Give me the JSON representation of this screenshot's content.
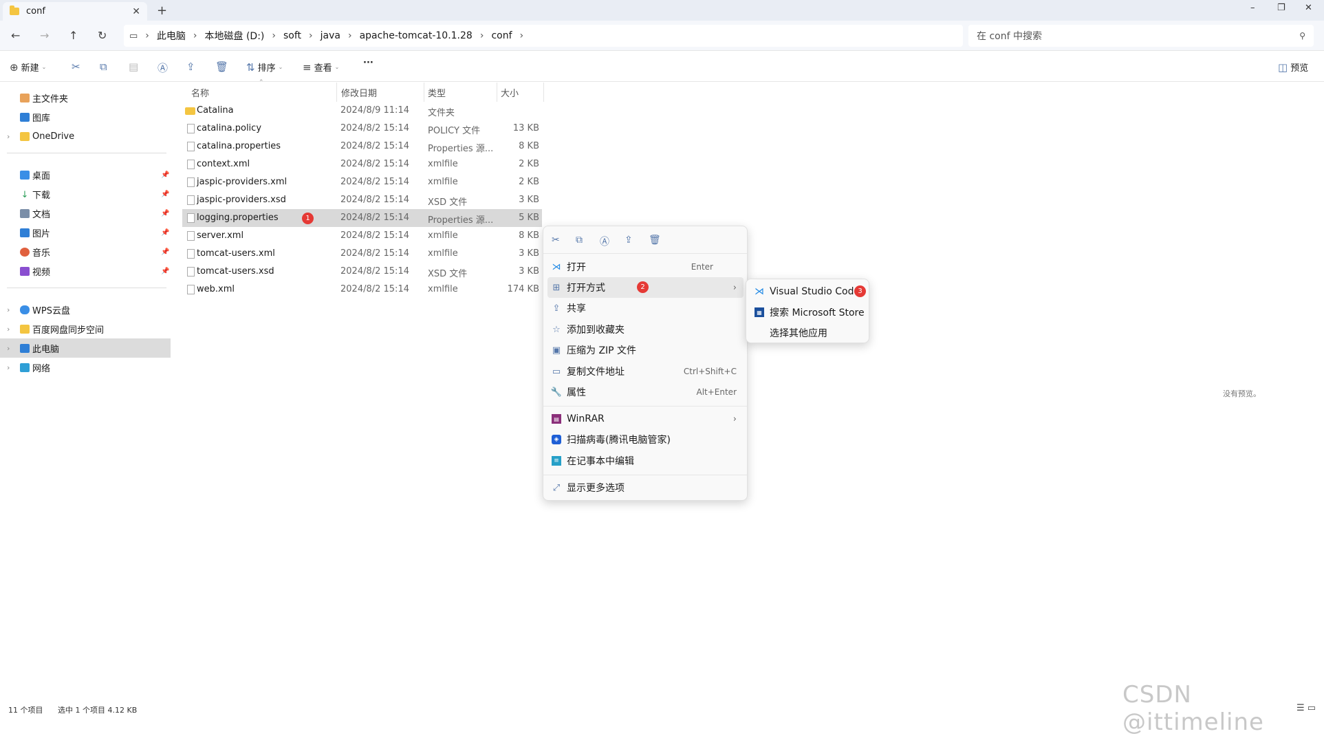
{
  "window": {
    "tab_title": "conf",
    "minimize": "–",
    "restore": "❐",
    "close": "✕"
  },
  "nav": {
    "crumbs": [
      "此电脑",
      "本地磁盘 (D:)",
      "soft",
      "java",
      "apache-tomcat-10.1.28",
      "conf"
    ],
    "search_placeholder": "在 conf 中搜索"
  },
  "toolbar": {
    "new_label": "新建",
    "sort_label": "排序",
    "view_label": "查看",
    "more": "···",
    "preview_label": "预览"
  },
  "sidebar": {
    "top": [
      "主文件夹",
      "图库",
      "OneDrive"
    ],
    "quick": [
      "桌面",
      "下载",
      "文档",
      "图片",
      "音乐",
      "视频"
    ],
    "bottom": [
      "WPS云盘",
      "百度网盘同步空间",
      "此电脑",
      "网络"
    ]
  },
  "columns": [
    "名称",
    "修改日期",
    "类型",
    "大小"
  ],
  "files": [
    {
      "name": "Catalina",
      "date": "2024/8/9 11:14",
      "type": "文件夹",
      "size": ""
    },
    {
      "name": "catalina.policy",
      "date": "2024/8/2 15:14",
      "type": "POLICY 文件",
      "size": "13 KB"
    },
    {
      "name": "catalina.properties",
      "date": "2024/8/2 15:14",
      "type": "Properties 源...",
      "size": "8 KB"
    },
    {
      "name": "context.xml",
      "date": "2024/8/2 15:14",
      "type": "xmlfile",
      "size": "2 KB"
    },
    {
      "name": "jaspic-providers.xml",
      "date": "2024/8/2 15:14",
      "type": "xmlfile",
      "size": "2 KB"
    },
    {
      "name": "jaspic-providers.xsd",
      "date": "2024/8/2 15:14",
      "type": "XSD 文件",
      "size": "3 KB"
    },
    {
      "name": "logging.properties",
      "date": "2024/8/2 15:14",
      "type": "Properties 源...",
      "size": "5 KB"
    },
    {
      "name": "server.xml",
      "date": "2024/8/2 15:14",
      "type": "xmlfile",
      "size": "8 KB"
    },
    {
      "name": "tomcat-users.xml",
      "date": "2024/8/2 15:14",
      "type": "xmlfile",
      "size": "3 KB"
    },
    {
      "name": "tomcat-users.xsd",
      "date": "2024/8/2 15:14",
      "type": "XSD 文件",
      "size": "3 KB"
    },
    {
      "name": "web.xml",
      "date": "2024/8/2 15:14",
      "type": "xmlfile",
      "size": "174 KB"
    }
  ],
  "badges": {
    "one": "1",
    "two": "2",
    "three": "3"
  },
  "context_menu": {
    "open": "打开",
    "open_shortcut": "Enter",
    "open_with": "打开方式",
    "share": "共享",
    "favorite": "添加到收藏夹",
    "zip": "压缩为 ZIP 文件",
    "copy_path": "复制文件地址",
    "copy_path_shortcut": "Ctrl+Shift+C",
    "properties": "属性",
    "properties_shortcut": "Alt+Enter",
    "winrar": "WinRAR",
    "scan": "扫描病毒(腾讯电脑管家)",
    "notepad": "在记事本中编辑",
    "more": "显示更多选项"
  },
  "submenu": {
    "vscode": "Visual Studio Code",
    "store": "搜索 Microsoft Store",
    "other": "选择其他应用"
  },
  "preview": {
    "no_preview": "没有预览。"
  },
  "status": {
    "count": "11 个项目",
    "selected": "选中 1 个项目  4.12 KB"
  },
  "watermark": "CSDN @ittimeline"
}
